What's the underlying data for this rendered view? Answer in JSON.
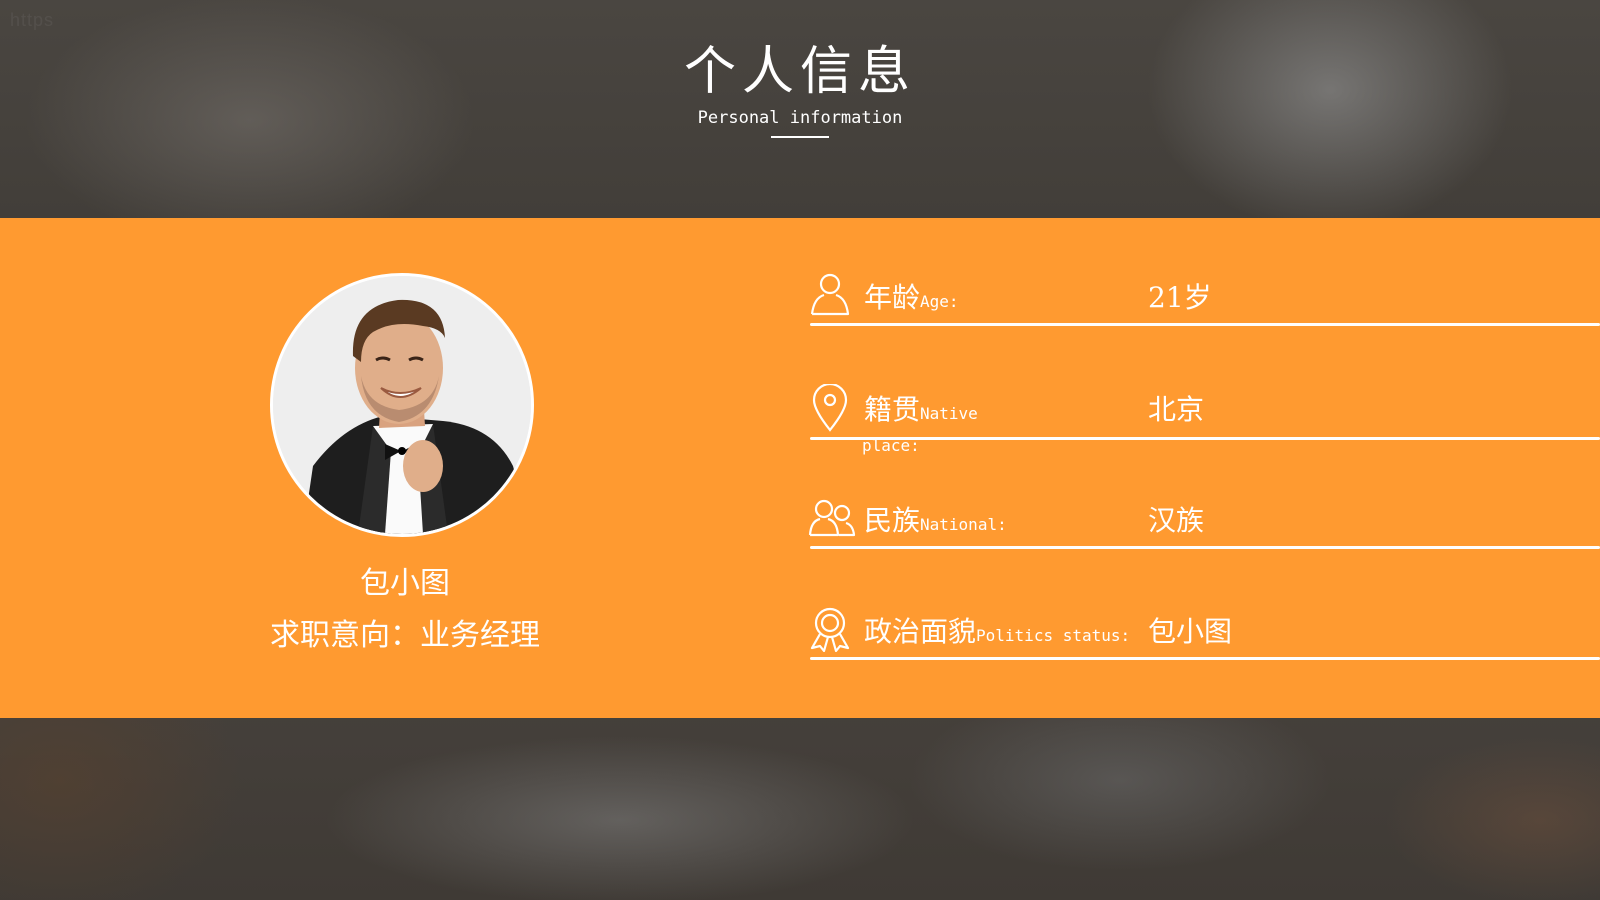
{
  "header": {
    "title_cn": "个人信息",
    "title_en": "Personal information"
  },
  "profile": {
    "avatar_icon": "portrait-photo",
    "name": "包小图",
    "objective": "求职意向：业务经理"
  },
  "info": [
    {
      "icon": "person-icon",
      "label_cn": "年龄",
      "label_en": "Age:",
      "value": "21岁"
    },
    {
      "icon": "location-pin-icon",
      "label_cn": "籍贯",
      "label_en_line1": "Native",
      "label_en_line2": "place:",
      "value": "北京"
    },
    {
      "icon": "group-icon",
      "label_cn": "民族",
      "label_en": "National:",
      "value": "汉族"
    },
    {
      "icon": "award-ribbon-icon",
      "label_cn": "政治面貌",
      "label_en": "Politics status:",
      "value": "包小图"
    }
  ],
  "colors": {
    "band": "#ff9a30",
    "text": "#ffffff",
    "background": "#3d3934"
  }
}
